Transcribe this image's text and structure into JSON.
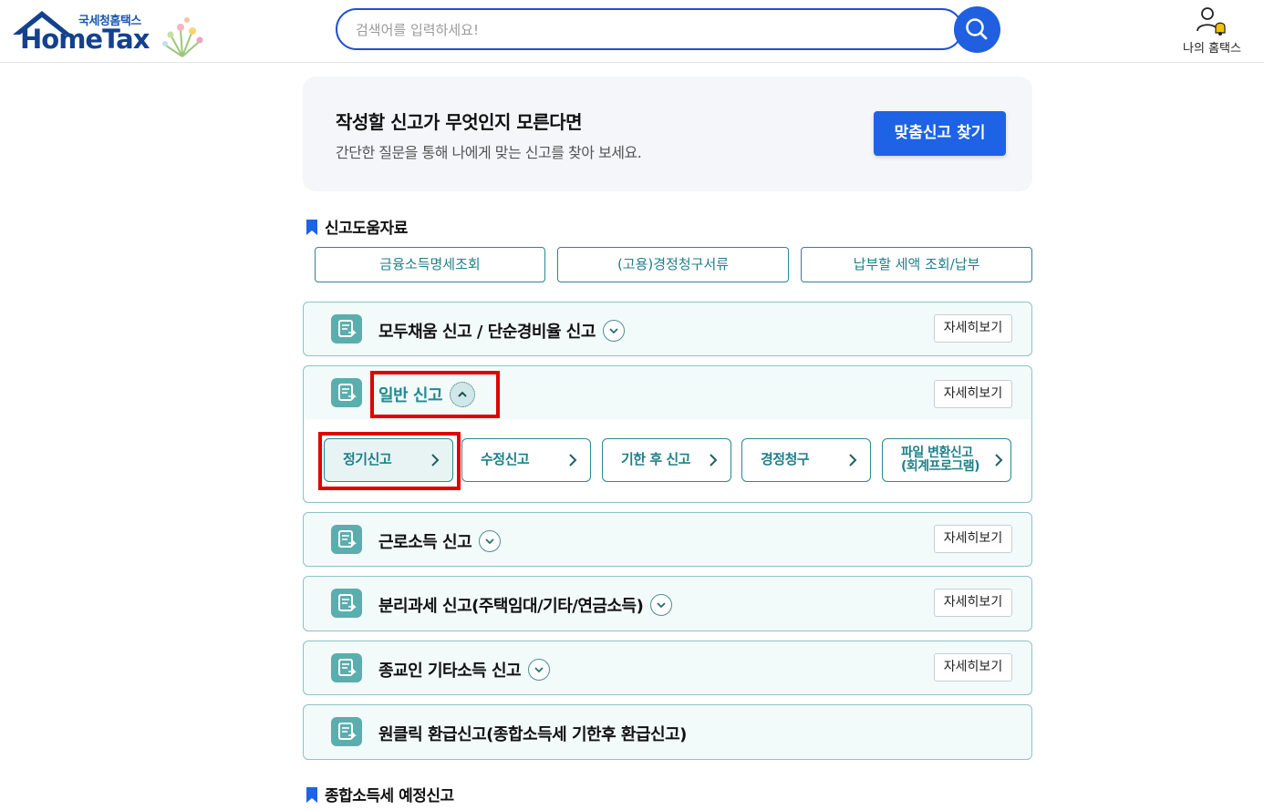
{
  "header": {
    "logo_sub": "국세청홈택스",
    "logo_main": "HomeTax",
    "search_placeholder": "검색어를 입력하세요!",
    "my_hometax": "나의 홈택스",
    "brand_color": "#1f5fe0"
  },
  "banner": {
    "title": "작성할 신고가 무엇인지 모른다면",
    "desc": "간단한 질문을 통해 나에게 맞는 신고를 찾아 보세요.",
    "button": "맞춤신고 찾기"
  },
  "help_section": {
    "title": "신고도움자료",
    "buttons": [
      "금융소득명세조회",
      "(고용)경정청구서류",
      "납부할 세액 조회/납부"
    ]
  },
  "cards": [
    {
      "title": "모두채움 신고 / 단순경비율 신고",
      "detail": "자세히보기",
      "expanded": false
    },
    {
      "title": "일반 신고",
      "detail": "자세히보기",
      "expanded": true,
      "sub_buttons": [
        "정기신고",
        "수정신고",
        "기한 후 신고",
        "경정청구",
        "파일 변환신고\n(회계프로그램)"
      ]
    },
    {
      "title": "근로소득 신고",
      "detail": "자세히보기",
      "expanded": false
    },
    {
      "title": "분리과세 신고(주택임대/기타/연금소득)",
      "detail": "자세히보기",
      "expanded": false
    },
    {
      "title": "종교인 기타소득 신고",
      "detail": "자세히보기",
      "expanded": false
    },
    {
      "title": "원클릭 환급신고(종합소득세 기한후 환급신고)",
      "expanded": false
    }
  ],
  "next_section": {
    "title": "종합소득세 예정신고"
  },
  "colors": {
    "accent_teal": "#2a8790",
    "highlight_red": "#e00000",
    "primary_blue": "#1e62e5"
  }
}
